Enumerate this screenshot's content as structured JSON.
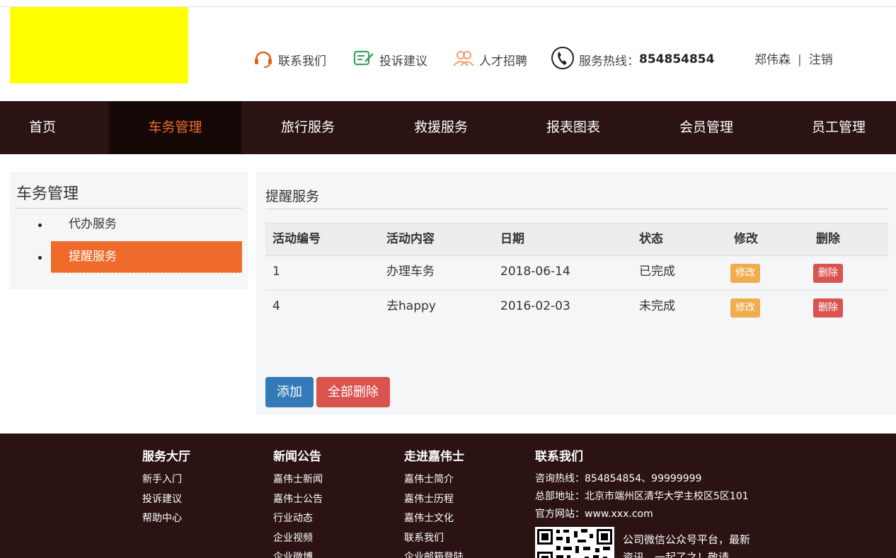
{
  "header": {
    "links": [
      {
        "label": "联系我们",
        "icon": "headset-icon"
      },
      {
        "label": "投诉建议",
        "icon": "edit-note-icon"
      },
      {
        "label": "人才招聘",
        "icon": "people-icon"
      },
      {
        "label": "服务热线：",
        "icon": "phone-icon"
      }
    ],
    "hotline": "854854854",
    "user": "郑伟森",
    "separator": "|",
    "logout": "注销"
  },
  "nav": {
    "items": [
      "首页",
      "车务管理",
      "旅行服务",
      "救援服务",
      "报表图表",
      "会员管理",
      "员工管理"
    ],
    "active_index": 1
  },
  "sidebar": {
    "title": "车务管理",
    "items": [
      "代办服务",
      "提醒服务"
    ],
    "active_index": 1
  },
  "main": {
    "title": "提醒服务",
    "columns": [
      "活动编号",
      "活动内容",
      "日期",
      "状态",
      "修改",
      "删除"
    ],
    "rows": [
      {
        "id": "1",
        "content": "办理车务",
        "date": "2018-06-14",
        "status": "已完成",
        "edit": "修改",
        "delete": "删除"
      },
      {
        "id": "4",
        "content": "去happy",
        "date": "2016-02-03",
        "status": "未完成",
        "edit": "修改",
        "delete": "删除"
      }
    ],
    "add_label": "添加",
    "delete_all_label": "全部删除"
  },
  "footer": {
    "columns": [
      {
        "title": "服务大厅",
        "links": [
          "新手入门",
          "投诉建议",
          "帮助中心"
        ]
      },
      {
        "title": "新闻公告",
        "links": [
          "嘉伟士新闻",
          "嘉伟士公告",
          "行业动态",
          "企业视频",
          "企业微博"
        ]
      },
      {
        "title": "走进嘉伟士",
        "links": [
          "嘉伟士简介",
          "嘉伟士历程",
          "嘉伟士文化",
          "联系我们",
          "企业邮箱登陆"
        ]
      }
    ],
    "contact": {
      "title": "联系我们",
      "lines": [
        "咨询热线：854854854、99999999",
        "总部地址：北京市端州区清华大学主校区5区101",
        "官方网站：www.xxx.com"
      ],
      "qr_text": "公司微信公众号平台，最新资讯，一起了之！敬请"
    }
  },
  "colors": {
    "nav_bg": "#2b1213",
    "accent": "#ee6b2c",
    "logo": "#ffff00",
    "primary": "#337ab7",
    "danger": "#d9534f",
    "warning": "#f0ad4e"
  }
}
